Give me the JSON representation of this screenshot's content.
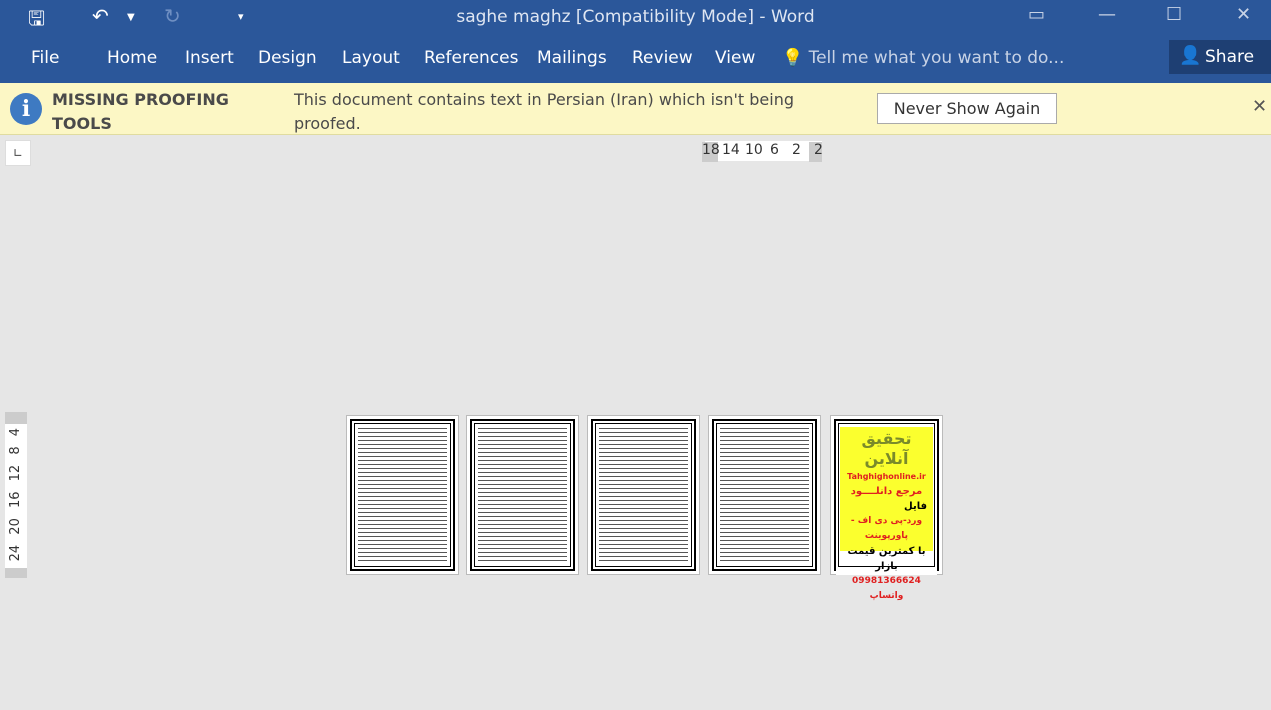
{
  "window": {
    "title": "saghe maghz [Compatibility Mode] - Word"
  },
  "quick_access": {
    "save_icon": "save-icon",
    "undo_icon": "undo-icon",
    "redo_icon": "redo-icon",
    "customize_icon": "dropdown-icon"
  },
  "window_controls": {
    "restore": "▭",
    "minimize": "—",
    "maximize": "☐",
    "close": "✕"
  },
  "tabs": [
    "File",
    "Home",
    "Insert",
    "Design",
    "Layout",
    "References",
    "Mailings",
    "Review",
    "View"
  ],
  "tell_me": "Tell me what you want to do...",
  "share": "Share",
  "message_bar": {
    "title": "MISSING PROOFING TOOLS",
    "text": "This document contains text in Persian (Iran) which isn't being proofed.",
    "button": "Never Show Again",
    "close": "✕"
  },
  "ruler": {
    "horizontal": [
      "18",
      "14",
      "10",
      "6",
      "2",
      "2"
    ],
    "vertical": "24 20 16 12 8 4"
  },
  "ad_page": {
    "line1": "تحقیق آنلاین",
    "line2": "Tahghighonline.ir",
    "line3": "مرجع دانلــــود",
    "line4": "فایل",
    "line5": "ورد-پی دی اف - پاورپوینت",
    "line6": "با کمترین قیمت بازار",
    "line7": "09981366624 واتساپ"
  },
  "colors": {
    "ribbon": "#2b579a",
    "message_bar": "#fcf7c5",
    "ad_background": "#fbff2e"
  }
}
